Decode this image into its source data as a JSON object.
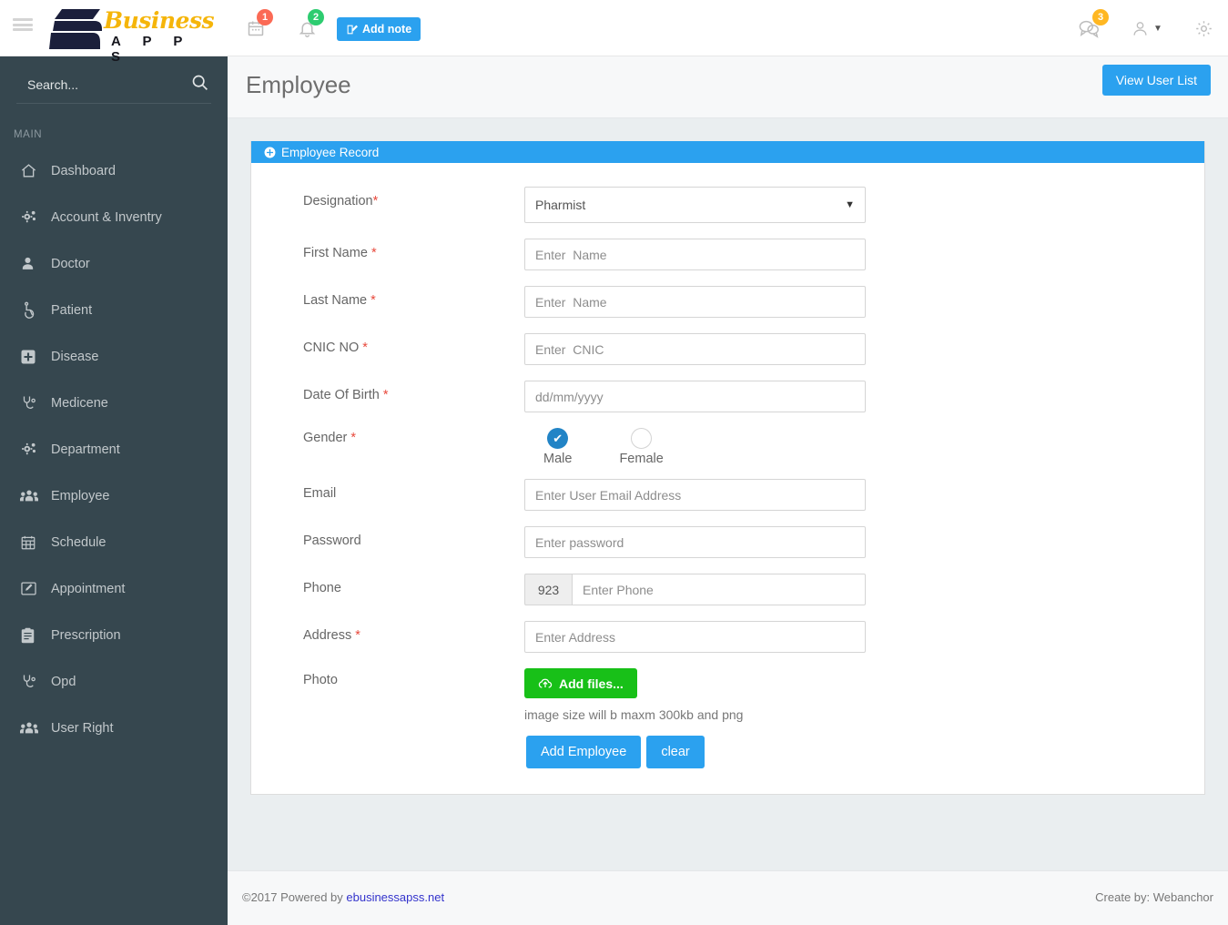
{
  "header": {
    "menu_toggle_label": "Toggle navigation",
    "logo": {
      "brand": "Business",
      "sub": "A P P S"
    },
    "calendar_badge": "1",
    "bell_badge": "2",
    "chat_badge": "3",
    "add_note_label": "Add note"
  },
  "sidebar": {
    "search_placeholder": "Search...",
    "search_value": "",
    "section_title": "MAIN",
    "items": [
      {
        "label": "Dashboard",
        "icon": "home-icon"
      },
      {
        "label": "Account & Inventry",
        "icon": "cogs-icon"
      },
      {
        "label": "Doctor",
        "icon": "user-icon"
      },
      {
        "label": "Patient",
        "icon": "wheelchair-icon"
      },
      {
        "label": "Disease",
        "icon": "plus-square-icon"
      },
      {
        "label": "Medicene",
        "icon": "stethoscope-icon"
      },
      {
        "label": "Department",
        "icon": "cogs-icon"
      },
      {
        "label": "Employee",
        "icon": "users-icon"
      },
      {
        "label": "Schedule",
        "icon": "calendar-icon"
      },
      {
        "label": "Appointment",
        "icon": "edit-icon"
      },
      {
        "label": "Prescription",
        "icon": "clipboard-icon"
      },
      {
        "label": "Opd",
        "icon": "stethoscope-icon"
      },
      {
        "label": "User Right",
        "icon": "users-icon"
      }
    ]
  },
  "page": {
    "title": "Employee",
    "view_user_list_label": "View User List"
  },
  "panel": {
    "title": "Employee Record",
    "fields": {
      "designation": {
        "label": "Designation",
        "required": "*",
        "value": "Pharmist",
        "options": [
          "Pharmist"
        ]
      },
      "first_name": {
        "label": "First Name",
        "required": "*",
        "placeholder": "Enter  Name",
        "value": ""
      },
      "last_name": {
        "label": "Last Name",
        "required": "*",
        "placeholder": "Enter  Name",
        "value": ""
      },
      "cnic": {
        "label": "CNIC NO",
        "required": "*",
        "placeholder": "Enter  CNIC",
        "value": ""
      },
      "dob": {
        "label": "Date Of Birth",
        "required": "*",
        "placeholder": "dd/mm/yyyy",
        "value": ""
      },
      "gender": {
        "label": "Gender",
        "required": "*",
        "selected": "Male",
        "options": [
          {
            "label": "Male",
            "checked": true
          },
          {
            "label": "Female",
            "checked": false
          }
        ]
      },
      "email": {
        "label": "Email",
        "required": "",
        "placeholder": "Enter User Email Address",
        "value": ""
      },
      "password": {
        "label": "Password",
        "required": "",
        "placeholder": "Enter password",
        "value": ""
      },
      "phone": {
        "label": "Phone",
        "required": "",
        "prefix": "923",
        "placeholder": "Enter Phone",
        "value": ""
      },
      "address": {
        "label": "Address",
        "required": "*",
        "placeholder": "Enter Address",
        "value": ""
      },
      "photo": {
        "label": "Photo",
        "add_files_label": "Add files...",
        "hint": "image size will b maxm 300kb and png"
      }
    },
    "actions": {
      "submit_label": "Add Employee",
      "clear_label": "clear"
    }
  },
  "footer": {
    "copyright_prefix": "©2017 Powered by ",
    "link_text": "ebusinessapss.net",
    "credit": "Create by: Webanchor"
  },
  "colors": {
    "accent_blue": "#2ba1ef",
    "sidebar_bg": "#36474f",
    "content_bg": "#eaeef0",
    "green": "#18c018",
    "badge_red": "#fb6a55",
    "badge_green": "#2dcc70",
    "badge_orange": "#ffb722",
    "required_red": "#e8493c"
  }
}
